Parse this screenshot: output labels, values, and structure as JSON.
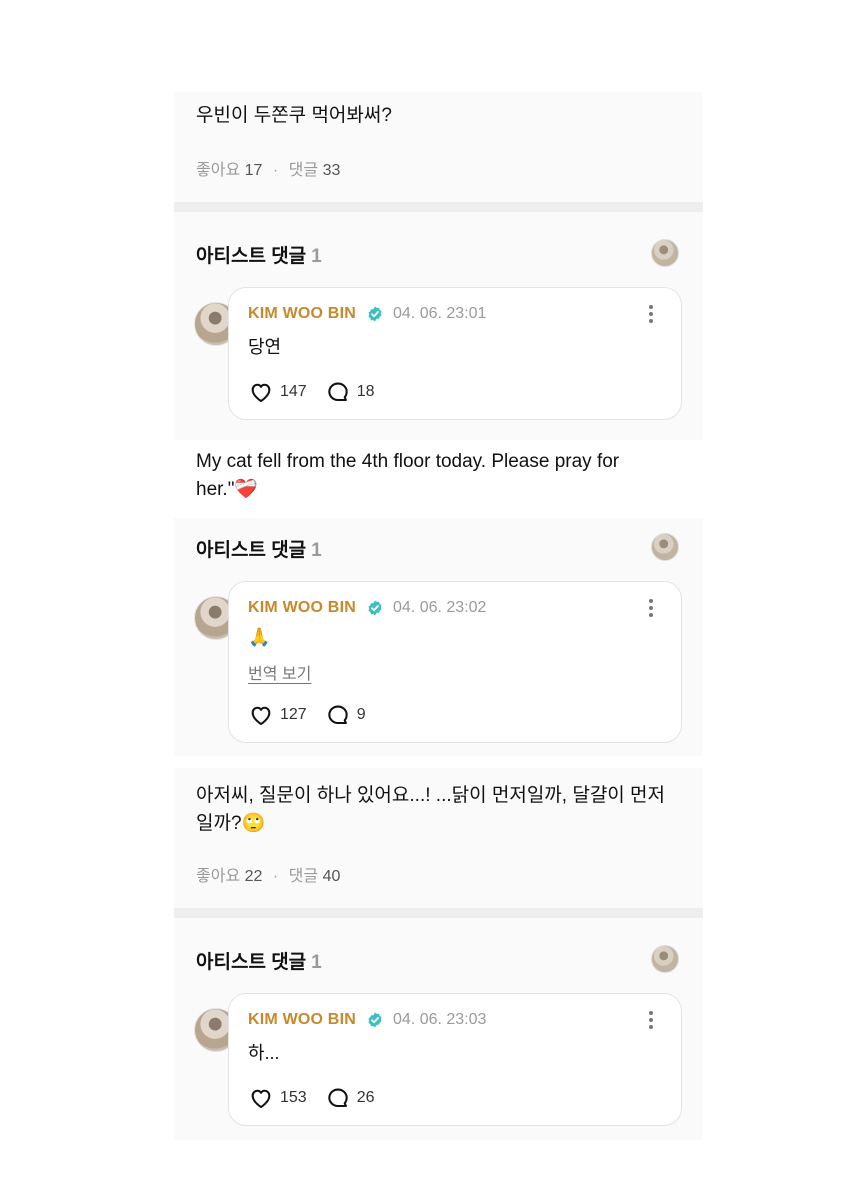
{
  "post1": {
    "text": "우빈이 두쫀쿠 먹어봐써?",
    "likes_label": "좋아요",
    "likes": "17",
    "comments_label": "댓글",
    "comments": "33"
  },
  "artist_header": {
    "label": "아티스트 댓글",
    "count": "1"
  },
  "comment1": {
    "name": "KIM WOO BIN",
    "time": "04. 06. 23:01",
    "text": "당연",
    "likes": "147",
    "replies": "18"
  },
  "post2": {
    "text": "My cat fell from the 4th floor today. Please pray for her.\"❤️‍🩹"
  },
  "comment2": {
    "name": "KIM WOO BIN",
    "time": "04. 06. 23:02",
    "text": "🙏",
    "translate": "번역 보기",
    "likes": "127",
    "replies": "9"
  },
  "post3": {
    "text": "아저씨, 질문이 하나 있어요...! ...닭이 먼저일까, 달걀이 먼저일까?🙄",
    "likes_label": "좋아요",
    "likes": "22",
    "comments_label": "댓글",
    "comments": "40"
  },
  "comment3": {
    "name": "KIM WOO BIN",
    "time": "04. 06. 23:03",
    "text": "하...",
    "likes": "153",
    "replies": "26"
  },
  "colors": {
    "name": "#c7892b",
    "verified": "#3cbfc4",
    "muted": "#9a9a9a",
    "separator": "#eeeeee"
  },
  "icons": [
    "verified-badge-icon",
    "heart-icon",
    "comment-bubble-icon",
    "kebab-menu-icon"
  ]
}
